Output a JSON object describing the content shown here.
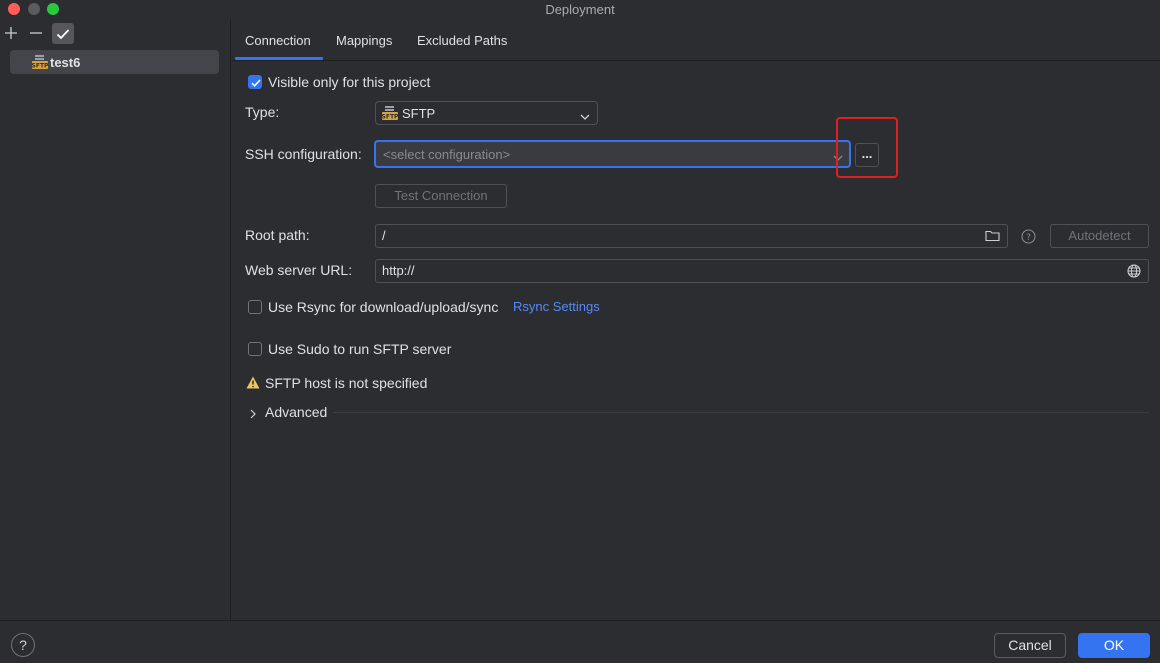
{
  "window": {
    "title": "Deployment"
  },
  "left_pane": {
    "toolbar": {
      "add_icon": "plus-icon",
      "remove_icon": "minus-icon",
      "apply_icon": "check-icon"
    },
    "servers": [
      {
        "label": "test6",
        "icon": "sftp-server-icon",
        "selected": true
      }
    ]
  },
  "tabs": [
    {
      "label": "Connection",
      "active": true
    },
    {
      "label": "Mappings",
      "active": false
    },
    {
      "label": "Excluded Paths",
      "active": false
    }
  ],
  "form": {
    "visible_only": {
      "label": "Visible only for this project",
      "checked": true
    },
    "type": {
      "label": "Type:",
      "value": "SFTP"
    },
    "ssh_config": {
      "label": "SSH configuration:",
      "placeholder": "<select configuration>",
      "browse_label": "..."
    },
    "test_connection": {
      "label": "Test Connection"
    },
    "root_path": {
      "label": "Root path:",
      "value": "/",
      "autodetect_label": "Autodetect"
    },
    "web_server_url": {
      "label": "Web server URL:",
      "value": "http://"
    },
    "use_rsync": {
      "label": "Use Rsync for download/upload/sync",
      "checked": false,
      "link": "Rsync Settings"
    },
    "use_sudo": {
      "label": "Use Sudo to run SFTP server",
      "checked": false
    },
    "warning": {
      "text": "SFTP host is not specified",
      "color": "#f2c55c"
    },
    "advanced": {
      "label": "Advanced"
    }
  },
  "footer": {
    "help_label": "?",
    "cancel_label": "Cancel",
    "ok_label": "OK"
  },
  "colors": {
    "accent": "#3574f0",
    "background": "#2b2d30",
    "highlight": "#e02020"
  }
}
